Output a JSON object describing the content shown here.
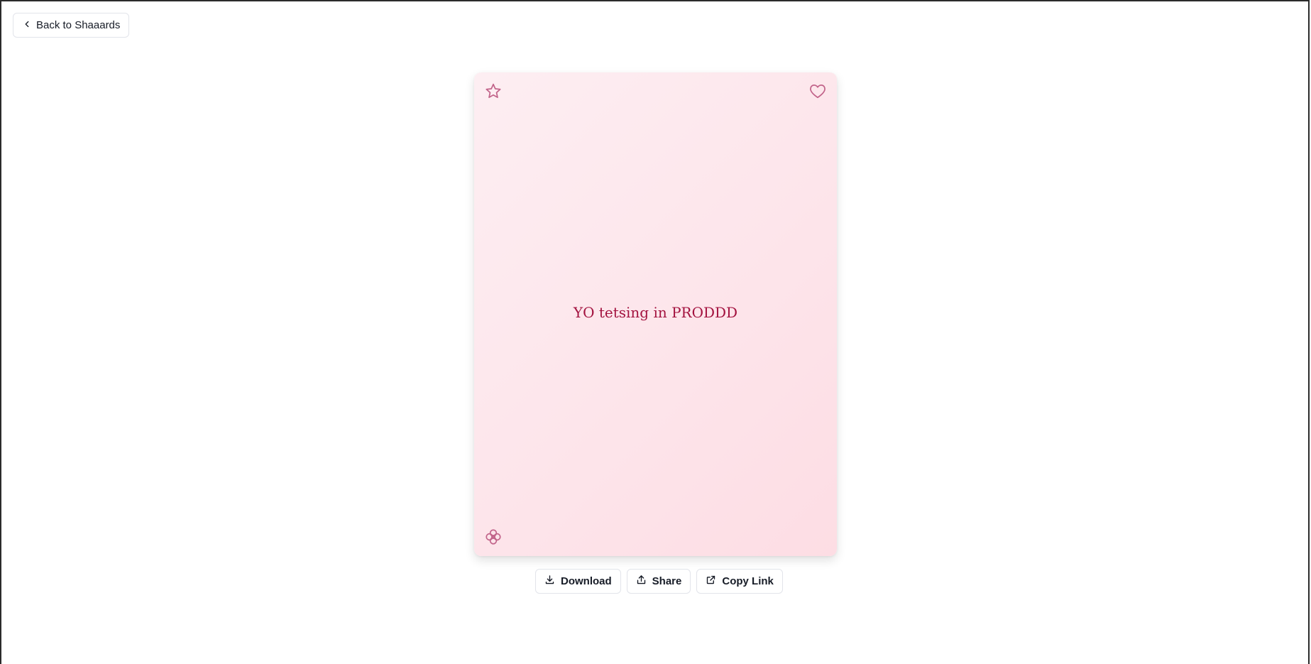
{
  "nav": {
    "back_label": "Back to Shaaards"
  },
  "card": {
    "message": "YO tetsing in PRODDD",
    "icons": [
      "star-icon",
      "heart-icon",
      "flower-icon"
    ],
    "colors": {
      "background": "#fde6ec",
      "text": "#a3123f",
      "icon": "#c2648a"
    }
  },
  "actions": {
    "download_label": "Download",
    "share_label": "Share",
    "copy_link_label": "Copy Link"
  }
}
